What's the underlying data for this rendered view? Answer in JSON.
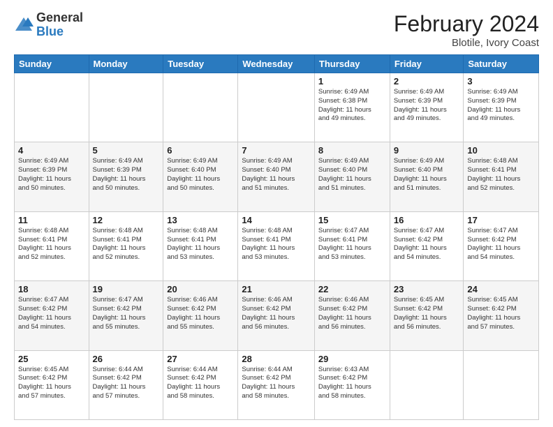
{
  "header": {
    "logo_general": "General",
    "logo_blue": "Blue",
    "title": "February 2024",
    "location": "Blotile, Ivory Coast"
  },
  "weekdays": [
    "Sunday",
    "Monday",
    "Tuesday",
    "Wednesday",
    "Thursday",
    "Friday",
    "Saturday"
  ],
  "weeks": [
    [
      {
        "day": "",
        "info": ""
      },
      {
        "day": "",
        "info": ""
      },
      {
        "day": "",
        "info": ""
      },
      {
        "day": "",
        "info": ""
      },
      {
        "day": "1",
        "info": "Sunrise: 6:49 AM\nSunset: 6:38 PM\nDaylight: 11 hours\nand 49 minutes."
      },
      {
        "day": "2",
        "info": "Sunrise: 6:49 AM\nSunset: 6:39 PM\nDaylight: 11 hours\nand 49 minutes."
      },
      {
        "day": "3",
        "info": "Sunrise: 6:49 AM\nSunset: 6:39 PM\nDaylight: 11 hours\nand 49 minutes."
      }
    ],
    [
      {
        "day": "4",
        "info": "Sunrise: 6:49 AM\nSunset: 6:39 PM\nDaylight: 11 hours\nand 50 minutes."
      },
      {
        "day": "5",
        "info": "Sunrise: 6:49 AM\nSunset: 6:39 PM\nDaylight: 11 hours\nand 50 minutes."
      },
      {
        "day": "6",
        "info": "Sunrise: 6:49 AM\nSunset: 6:40 PM\nDaylight: 11 hours\nand 50 minutes."
      },
      {
        "day": "7",
        "info": "Sunrise: 6:49 AM\nSunset: 6:40 PM\nDaylight: 11 hours\nand 51 minutes."
      },
      {
        "day": "8",
        "info": "Sunrise: 6:49 AM\nSunset: 6:40 PM\nDaylight: 11 hours\nand 51 minutes."
      },
      {
        "day": "9",
        "info": "Sunrise: 6:49 AM\nSunset: 6:40 PM\nDaylight: 11 hours\nand 51 minutes."
      },
      {
        "day": "10",
        "info": "Sunrise: 6:48 AM\nSunset: 6:41 PM\nDaylight: 11 hours\nand 52 minutes."
      }
    ],
    [
      {
        "day": "11",
        "info": "Sunrise: 6:48 AM\nSunset: 6:41 PM\nDaylight: 11 hours\nand 52 minutes."
      },
      {
        "day": "12",
        "info": "Sunrise: 6:48 AM\nSunset: 6:41 PM\nDaylight: 11 hours\nand 52 minutes."
      },
      {
        "day": "13",
        "info": "Sunrise: 6:48 AM\nSunset: 6:41 PM\nDaylight: 11 hours\nand 53 minutes."
      },
      {
        "day": "14",
        "info": "Sunrise: 6:48 AM\nSunset: 6:41 PM\nDaylight: 11 hours\nand 53 minutes."
      },
      {
        "day": "15",
        "info": "Sunrise: 6:47 AM\nSunset: 6:41 PM\nDaylight: 11 hours\nand 53 minutes."
      },
      {
        "day": "16",
        "info": "Sunrise: 6:47 AM\nSunset: 6:42 PM\nDaylight: 11 hours\nand 54 minutes."
      },
      {
        "day": "17",
        "info": "Sunrise: 6:47 AM\nSunset: 6:42 PM\nDaylight: 11 hours\nand 54 minutes."
      }
    ],
    [
      {
        "day": "18",
        "info": "Sunrise: 6:47 AM\nSunset: 6:42 PM\nDaylight: 11 hours\nand 54 minutes."
      },
      {
        "day": "19",
        "info": "Sunrise: 6:47 AM\nSunset: 6:42 PM\nDaylight: 11 hours\nand 55 minutes."
      },
      {
        "day": "20",
        "info": "Sunrise: 6:46 AM\nSunset: 6:42 PM\nDaylight: 11 hours\nand 55 minutes."
      },
      {
        "day": "21",
        "info": "Sunrise: 6:46 AM\nSunset: 6:42 PM\nDaylight: 11 hours\nand 56 minutes."
      },
      {
        "day": "22",
        "info": "Sunrise: 6:46 AM\nSunset: 6:42 PM\nDaylight: 11 hours\nand 56 minutes."
      },
      {
        "day": "23",
        "info": "Sunrise: 6:45 AM\nSunset: 6:42 PM\nDaylight: 11 hours\nand 56 minutes."
      },
      {
        "day": "24",
        "info": "Sunrise: 6:45 AM\nSunset: 6:42 PM\nDaylight: 11 hours\nand 57 minutes."
      }
    ],
    [
      {
        "day": "25",
        "info": "Sunrise: 6:45 AM\nSunset: 6:42 PM\nDaylight: 11 hours\nand 57 minutes."
      },
      {
        "day": "26",
        "info": "Sunrise: 6:44 AM\nSunset: 6:42 PM\nDaylight: 11 hours\nand 57 minutes."
      },
      {
        "day": "27",
        "info": "Sunrise: 6:44 AM\nSunset: 6:42 PM\nDaylight: 11 hours\nand 58 minutes."
      },
      {
        "day": "28",
        "info": "Sunrise: 6:44 AM\nSunset: 6:42 PM\nDaylight: 11 hours\nand 58 minutes."
      },
      {
        "day": "29",
        "info": "Sunrise: 6:43 AM\nSunset: 6:42 PM\nDaylight: 11 hours\nand 58 minutes."
      },
      {
        "day": "",
        "info": ""
      },
      {
        "day": "",
        "info": ""
      }
    ]
  ]
}
